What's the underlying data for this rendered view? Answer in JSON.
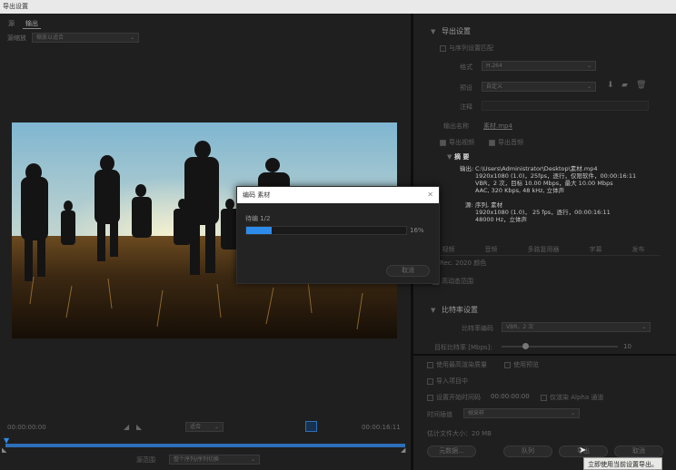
{
  "window": {
    "title": "导出设置"
  },
  "left": {
    "tabs": [
      {
        "label": "源"
      },
      {
        "label": "输出"
      }
    ],
    "source_scaling_label": "源缩放",
    "source_scaling_value": "缩放以适合",
    "timeline": {
      "start_time": "00:00:00:00",
      "end_time": "00:00:16:11",
      "fit_value": "适合",
      "source_range_label": "源范围",
      "source_range_value": "整个序列/序列切换"
    }
  },
  "right": {
    "export_settings_title": "导出设置",
    "match_sequence_label": "与序列设置匹配",
    "format_label": "格式",
    "format_value": "H.264",
    "preset_label": "预设",
    "preset_value": "自定义",
    "comment_label": "注释",
    "output_name_label": "输出名称",
    "output_name_value": "素材.mp4",
    "export_video_label": "导出视频",
    "export_audio_label": "导出音频",
    "summary_title": "摘 要",
    "summary_output_label": "输出",
    "summary_output_lines": [
      "C:\\Users\\Administrator\\Desktop\\素材.mp4",
      "1920x1080 (1.0)，25fps，逐行，仅限软件，00:00:16:11",
      "VBR，2 次，目标 10.00 Mbps，最大 10.00 Mbps",
      "AAC, 320 Kbps, 48  kHz, 立体声"
    ],
    "summary_source_label": "源",
    "summary_source_lines": [
      "序列, 素材",
      "1920x1080 (1.0)， 25 fps，逐行，00:00:16:11",
      "48000 Hz，立体声"
    ],
    "tabs": [
      "视频",
      "音频",
      "多路复用器",
      "字幕",
      "发布"
    ],
    "rec_label": "Rec. 2020 颜色",
    "hdr_label": "高动态范围",
    "bitrate_title": "比特率设置",
    "bitrate_encoding_label": "比特率编码",
    "bitrate_encoding_value": "VBR，2 次",
    "target_bitrate_label": "目标比特率 [Mbps]:",
    "target_bitrate_value": "10",
    "max_quality_label": "使用最高渲染质量",
    "use_preview_label": "使用预览",
    "import_project_label": "导入项目中",
    "set_start_timecode_label": "设置开始时间码",
    "start_timecode_value": "00:00:00:00",
    "render_alpha_label": "仅渲染 Alpha 通道",
    "time_interpolation_label": "时间插值",
    "time_interpolation_value": "帧采样",
    "estimated_size_label": "估计文件大小：",
    "estimated_size_value": "20 MB",
    "buttons": {
      "metadata": "元数据...",
      "queue": "队列",
      "export": "导出",
      "cancel": "取消"
    },
    "tooltip": "立即使用当前设置导出。"
  },
  "dialog": {
    "title": "编码 素材",
    "status": "待编 1/2",
    "percent_text": "16%",
    "progress": 0.16,
    "cancel_label": "取消"
  },
  "colors": {
    "accent": "#2d8ceb",
    "panel": "#1f1f1f",
    "background": "#141414"
  }
}
